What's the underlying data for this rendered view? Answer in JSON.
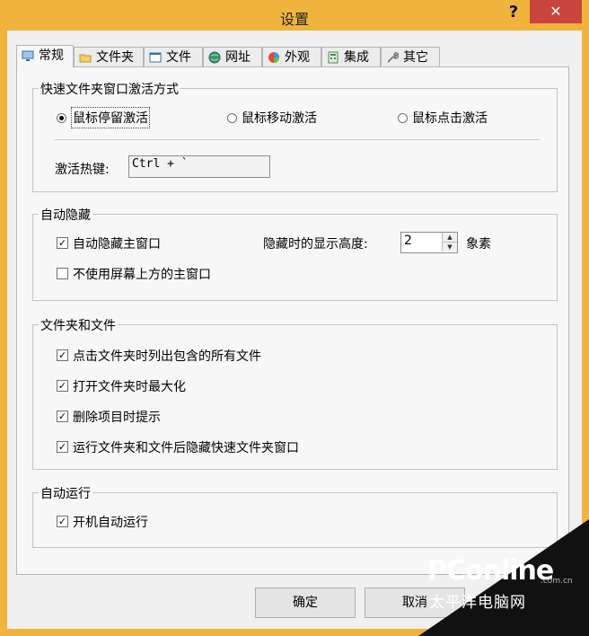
{
  "window": {
    "title": "设置",
    "help_label": "?",
    "close_label": "✕"
  },
  "tabs": [
    {
      "label": "常规",
      "icon": "monitor-icon",
      "active": true
    },
    {
      "label": "文件夹",
      "icon": "folder-icon"
    },
    {
      "label": "文件",
      "icon": "file-icon"
    },
    {
      "label": "网址",
      "icon": "globe-icon"
    },
    {
      "label": "外观",
      "icon": "palette-icon"
    },
    {
      "label": "集成",
      "icon": "calculator-icon"
    },
    {
      "label": "其它",
      "icon": "wrench-icon"
    }
  ],
  "activation": {
    "legend": "快速文件夹窗口激活方式",
    "options": [
      "鼠标停留激活",
      "鼠标移动激活",
      "鼠标点击激活"
    ],
    "selected_index": 0,
    "hotkey_label": "激活热键:",
    "hotkey_value": "Ctrl + `"
  },
  "autohide": {
    "legend": "自动隐藏",
    "hide_main": {
      "label": "自动隐藏主窗口",
      "checked": true
    },
    "no_top": {
      "label": "不使用屏幕上方的主窗口",
      "checked": false
    },
    "height_label": "隐藏时的显示高度:",
    "height_value": "2",
    "height_unit": "象素"
  },
  "files": {
    "legend": "文件夹和文件",
    "items": [
      {
        "label": "点击文件夹时列出包含的所有文件",
        "checked": true
      },
      {
        "label": "打开文件夹时最大化",
        "checked": true
      },
      {
        "label": "删除项目时提示",
        "checked": true
      },
      {
        "label": "运行文件夹和文件后隐藏快速文件夹窗口",
        "checked": true
      }
    ]
  },
  "autorun": {
    "legend": "自动运行",
    "item": {
      "label": "开机自动运行",
      "checked": true
    }
  },
  "buttons": {
    "ok": "确定",
    "cancel": "取消"
  },
  "watermark": {
    "brand": "PConline",
    "domain": ".com.cn",
    "chinese": "太平洋电脑网"
  },
  "colors": {
    "frame": "#f0b43c",
    "close": "#c7453c"
  }
}
